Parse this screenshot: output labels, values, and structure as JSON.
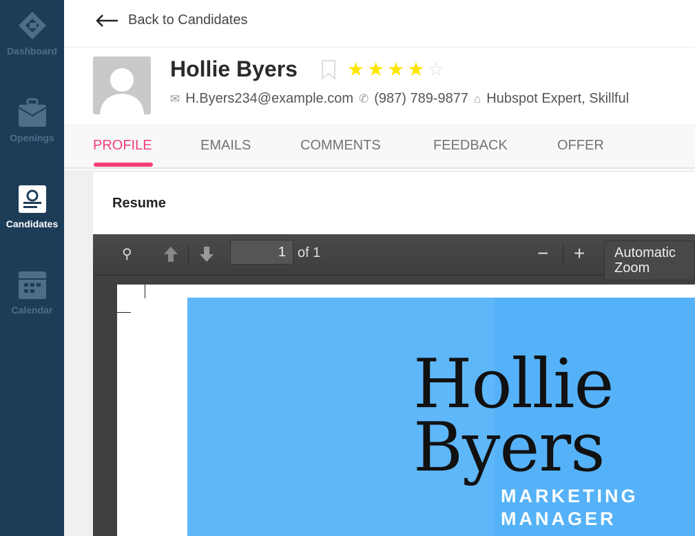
{
  "sidebar": {
    "items": [
      {
        "label": "Dashboard",
        "icon": "dashboard-logo-icon"
      },
      {
        "label": "Openings",
        "icon": "briefcase-icon"
      },
      {
        "label": "Candidates",
        "icon": "candidate-card-icon",
        "active": true
      },
      {
        "label": "Calendar",
        "icon": "calendar-icon"
      }
    ]
  },
  "header": {
    "back_label": "Back to Candidates"
  },
  "candidate": {
    "name": "Hollie Byers",
    "rating": 4,
    "max_rating": 5,
    "email": "H.Byers234@example.com",
    "phone": "(987) 789-9877",
    "tags": "Hubspot Expert, Skillful"
  },
  "tabs": [
    {
      "label": "PROFILE",
      "active": true
    },
    {
      "label": "EMAILS"
    },
    {
      "label": "COMMENTS"
    },
    {
      "label": "FEEDBACK"
    },
    {
      "label": "OFFER"
    }
  ],
  "resume": {
    "title": "Resume",
    "page_value": "1",
    "page_of": "of 1",
    "zoom": "Automatic Zoom",
    "doc_name": "Hollie Byers",
    "doc_title": "MARKETING MANAGER"
  },
  "colors": {
    "sidebar": "#1d3c58",
    "accent": "#f23d74",
    "star": "#ffe600",
    "banner": "#5eb7f9"
  }
}
